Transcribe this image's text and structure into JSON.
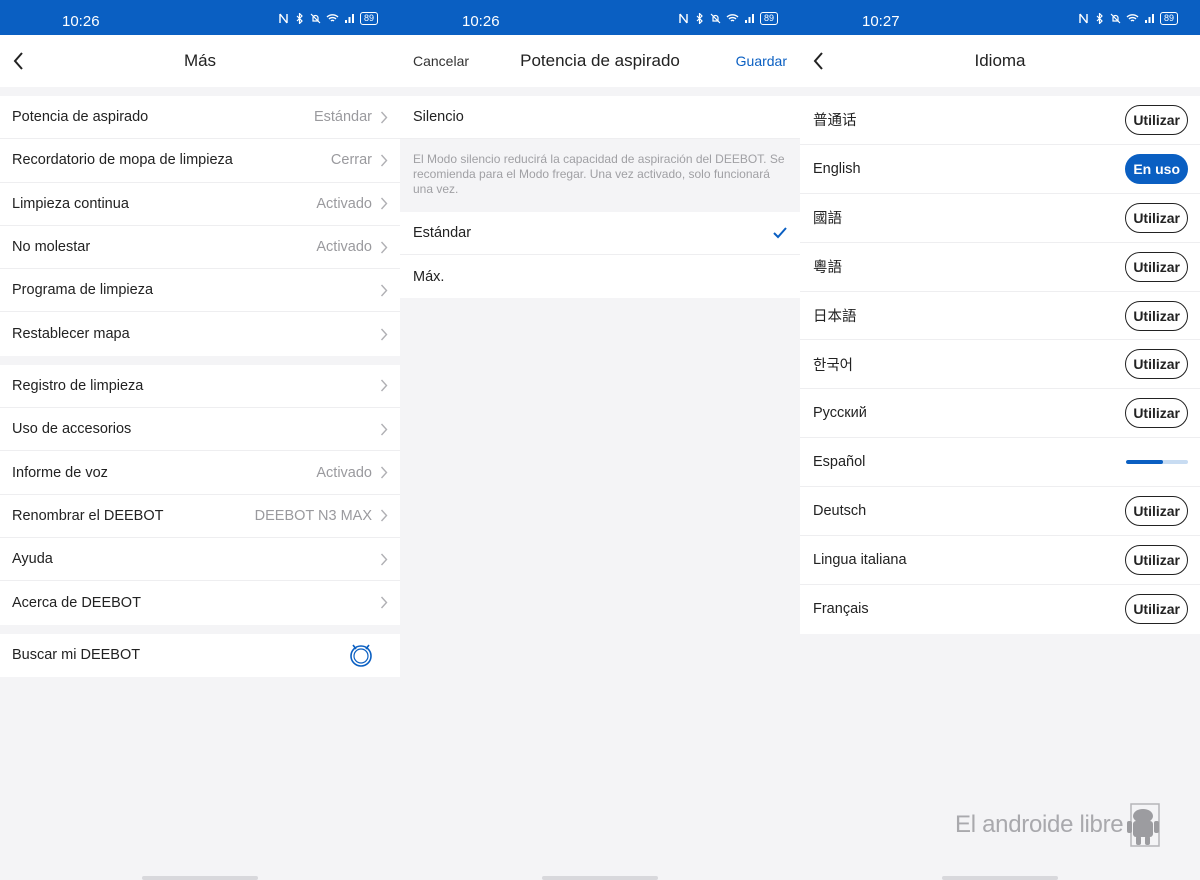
{
  "screen1": {
    "status": {
      "time": "10:26",
      "battery": "89"
    },
    "title": "Más",
    "group1": [
      {
        "label": "Potencia de aspirado",
        "value": "Estándar"
      },
      {
        "label": "Recordatorio de mopa de limpieza",
        "value": "Cerrar"
      },
      {
        "label": "Limpieza continua",
        "value": "Activado"
      },
      {
        "label": "No molestar",
        "value": "Activado"
      },
      {
        "label": "Programa de limpieza",
        "value": ""
      },
      {
        "label": "Restablecer mapa",
        "value": ""
      }
    ],
    "group2": [
      {
        "label": "Registro de limpieza",
        "value": ""
      },
      {
        "label": "Uso de accesorios",
        "value": ""
      },
      {
        "label": "Informe de voz",
        "value": "Activado"
      },
      {
        "label": "Renombrar el DEEBOT",
        "value": "DEEBOT N3 MAX"
      },
      {
        "label": "Ayuda",
        "value": ""
      },
      {
        "label": "Acerca de DEEBOT",
        "value": ""
      }
    ],
    "group3": {
      "label": "Buscar mi DEEBOT",
      "icon": "robot-icon"
    }
  },
  "screen2": {
    "status": {
      "time": "10:26",
      "battery": "89"
    },
    "cancel": "Cancelar",
    "title": "Potencia de aspirado",
    "save": "Guardar",
    "silence": "Silencio",
    "silence_desc": "El Modo silencio reducirá la capacidad de aspiración del DEEBOT. Se recomienda para el Modo fregar. Una vez activado, solo funcionará una vez.",
    "options": [
      {
        "label": "Estándar",
        "selected": true
      },
      {
        "label": "Máx.",
        "selected": false
      }
    ]
  },
  "screen3": {
    "status": {
      "time": "10:27",
      "battery": "89"
    },
    "title": "Idioma",
    "use_label": "Utilizar",
    "in_use_label": "En uso",
    "languages": [
      {
        "name": "普通话",
        "state": "use"
      },
      {
        "name": "English",
        "state": "in_use"
      },
      {
        "name": "國語",
        "state": "use"
      },
      {
        "name": "粵語",
        "state": "use"
      },
      {
        "name": "日本語",
        "state": "use"
      },
      {
        "name": "한국어",
        "state": "use"
      },
      {
        "name": "Русский",
        "state": "use"
      },
      {
        "name": "Español",
        "state": "loading",
        "progress": 0.6
      },
      {
        "name": "Deutsch",
        "state": "use"
      },
      {
        "name": "Lingua italiana",
        "state": "use"
      },
      {
        "name": "Français",
        "state": "use"
      }
    ]
  },
  "watermark": "El androide libre",
  "colors": {
    "accent": "#0a5fc2",
    "background": "#f4f4f6"
  }
}
